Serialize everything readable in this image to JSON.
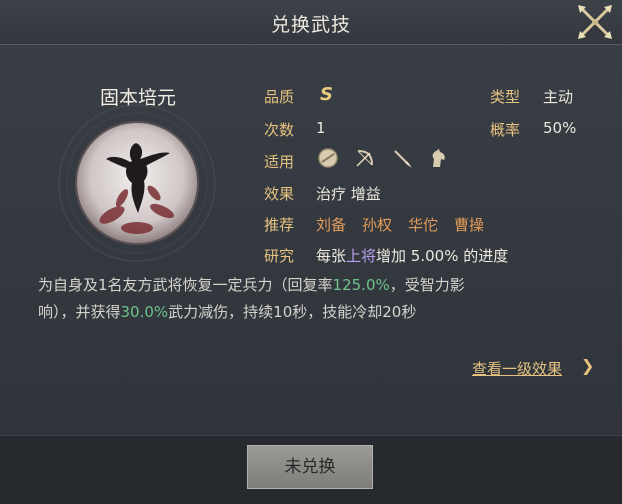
{
  "header": {
    "title": "兑换武技"
  },
  "skill": {
    "name": "固本培元",
    "grade_label": "品质",
    "grade": "S",
    "type_label": "类型",
    "type": "主动",
    "count_label": "次数",
    "count": "1",
    "rate_label": "概率",
    "rate": "50%",
    "apply_label": "适用",
    "apply_icons": [
      "shield-icon",
      "bow-icon",
      "spear-icon",
      "horse-icon"
    ],
    "effect_label": "效果",
    "effects": "治疗 增益",
    "recommend_label": "推荐",
    "recommend": [
      "刘备",
      "孙权",
      "华佗",
      "曹操"
    ],
    "research_label": "研究",
    "research": {
      "prefix": "每张",
      "highlight": "上将",
      "suffix": "增加 5.00% 的进度"
    },
    "description": {
      "line1_a": "为自身及1名友方武将恢复一定兵力（回复率",
      "line1_hl": "125.0%",
      "line1_b": "，受智力影",
      "line2_a": "响），并获得",
      "line2_hl": "30.0%",
      "line2_b": "武力减伤，持续10秒，技能冷却20秒"
    }
  },
  "links": {
    "view_level1": "查看一级效果",
    "chevron": "❯"
  },
  "footer": {
    "button_label": "未兑换"
  },
  "colors": {
    "accent": "#e6c380",
    "recommend": "#e39a58",
    "green": "#6ec28a",
    "purple": "#b8a0f0"
  }
}
